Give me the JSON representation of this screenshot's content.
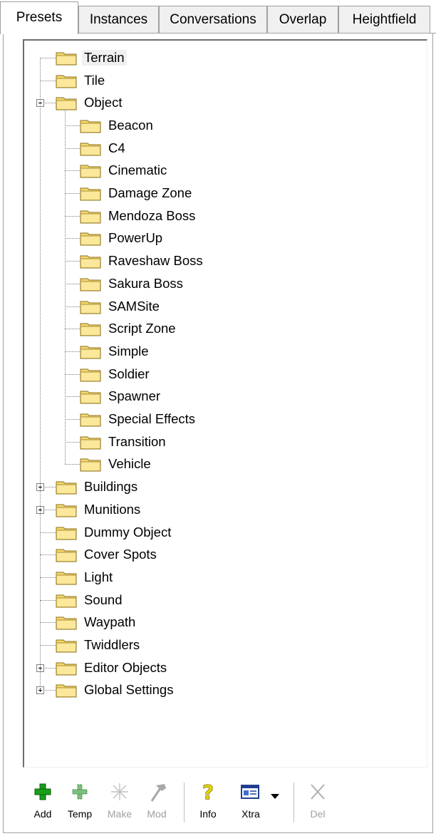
{
  "tabs": [
    {
      "label": "Presets",
      "active": true
    },
    {
      "label": "Instances",
      "active": false
    },
    {
      "label": "Conversations",
      "active": false
    },
    {
      "label": "Overlap",
      "active": false
    },
    {
      "label": "Heightfield",
      "active": false
    }
  ],
  "tree": {
    "root_items": [
      {
        "label": "Terrain",
        "expander": "none",
        "selected": true
      },
      {
        "label": "Tile",
        "expander": "none"
      },
      {
        "label": "Object",
        "expander": "minus"
      },
      {
        "label": "Buildings",
        "expander": "plus"
      },
      {
        "label": "Munitions",
        "expander": "plus"
      },
      {
        "label": "Dummy Object",
        "expander": "none"
      },
      {
        "label": "Cover Spots",
        "expander": "none"
      },
      {
        "label": "Light",
        "expander": "none"
      },
      {
        "label": "Sound",
        "expander": "none"
      },
      {
        "label": "Waypath",
        "expander": "none"
      },
      {
        "label": "Twiddlers",
        "expander": "none"
      },
      {
        "label": "Editor Objects",
        "expander": "plus"
      },
      {
        "label": "Global Settings",
        "expander": "plus"
      }
    ],
    "object_children": [
      "Beacon",
      "C4",
      "Cinematic",
      "Damage Zone",
      "Mendoza Boss",
      "PowerUp",
      "Raveshaw Boss",
      "Sakura Boss",
      "SAMSite",
      "Script Zone",
      "Simple",
      "Soldier",
      "Spawner",
      "Special Effects",
      "Transition",
      "Vehicle"
    ]
  },
  "toolbar": {
    "add_label": "Add",
    "temp_label": "Temp",
    "make_label": "Make",
    "mod_label": "Mod",
    "info_label": "Info",
    "xtra_label": "Xtra",
    "del_label": "Del"
  },
  "colors": {
    "folder_body": "#f6d86a",
    "folder_edge": "#8a7020",
    "add_green": "#1a9e1a",
    "info_yellow": "#e8d400",
    "disabled_gray": "#b0b0b0"
  }
}
